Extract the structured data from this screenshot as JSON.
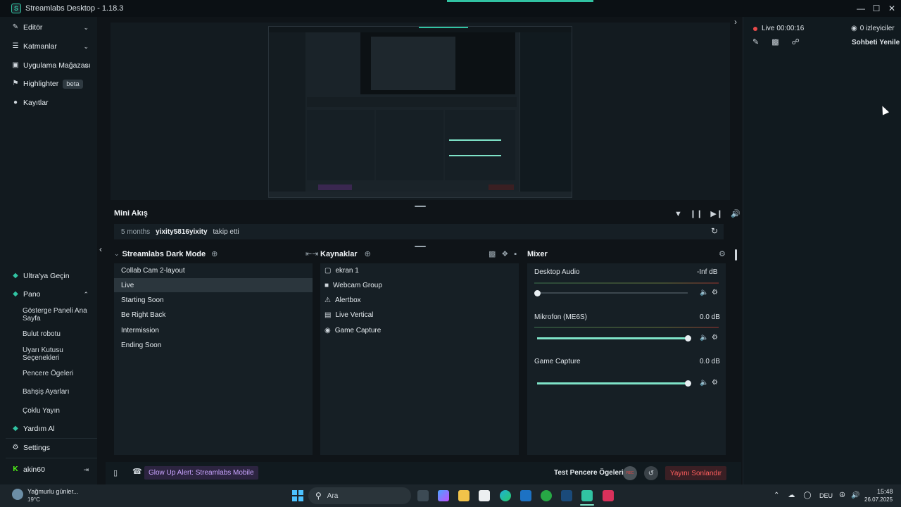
{
  "window": {
    "title": "Streamlabs Desktop - 1.18.3",
    "logo_letter": "S"
  },
  "sidebar": {
    "items": [
      {
        "label": "Editör",
        "icon": "pencil-icon"
      },
      {
        "label": "Katmanlar",
        "icon": "layers-icon"
      },
      {
        "label": "Uygulama Mağazası",
        "icon": "store-icon"
      },
      {
        "label": "Highlighter",
        "icon": "highlighter-icon",
        "badge": "beta"
      },
      {
        "label": "Kayıtlar",
        "icon": "recordings-icon"
      }
    ],
    "ultra": "Ultra'ya Geçin",
    "pano": "Pano",
    "pano_items": [
      "Gösterge Paneli Ana Sayfa",
      "Bulut robotu",
      "Uyarı Kutusu Seçenekleri",
      "Pencere Ögeleri",
      "Bahşiş Ayarları",
      "Çoklu Yayın"
    ],
    "help": "Yardım Al",
    "settings": "Settings",
    "user": "akin60"
  },
  "mini_feed": {
    "title": "Mini Akış",
    "event_time": "5 months",
    "event_user": "yixity5816yixity",
    "event_action": "takip etti"
  },
  "scenes": {
    "title": "Streamlabs Dark Mode",
    "items": [
      "Collab Cam 2-layout",
      "Live",
      "Starting Soon",
      "Be Right Back",
      "Intermission",
      "Ending Soon"
    ],
    "selected": "Live"
  },
  "sources": {
    "title": "Kaynaklar",
    "items": [
      {
        "label": "ekran 1",
        "icon": "monitor-icon"
      },
      {
        "label": "Webcam Group",
        "icon": "folder-icon"
      },
      {
        "label": "Alertbox",
        "icon": "alert-icon"
      },
      {
        "label": "Live Vertical",
        "icon": "browser-icon"
      },
      {
        "label": "Game Capture",
        "icon": "gamepad-icon"
      }
    ]
  },
  "mixer": {
    "title": "Mixer",
    "channels": [
      {
        "name": "Desktop Audio",
        "level": "-Inf dB",
        "volume_pct": 0
      },
      {
        "name": "Mikrofon (ME6S)",
        "level": "0.0 dB",
        "volume_pct": 100
      },
      {
        "name": "Game Capture",
        "level": "0.0 dB",
        "volume_pct": 100
      }
    ]
  },
  "footer": {
    "alert": "Glow Up Alert: Streamlabs Mobile",
    "test_label": "Test Pencere Ögeleri",
    "rec_label": "REC",
    "end_stream": "Yayını Sonlandır"
  },
  "right_panel": {
    "live_label": "Live",
    "live_time": "00:00:16",
    "viewers": "0 izleyiciler",
    "refresh_chat": "Sohbeti Yenile"
  },
  "taskbar": {
    "weather_title": "Yağmurlu günler...",
    "weather_temp": "19°C",
    "search": "Ara",
    "lang": "DEU",
    "time": "15:48",
    "date": "26.07.2025"
  },
  "colors": {
    "accent": "#31c3a2",
    "live_red": "#e84a4a",
    "end_stream": "#ff5e5e"
  }
}
